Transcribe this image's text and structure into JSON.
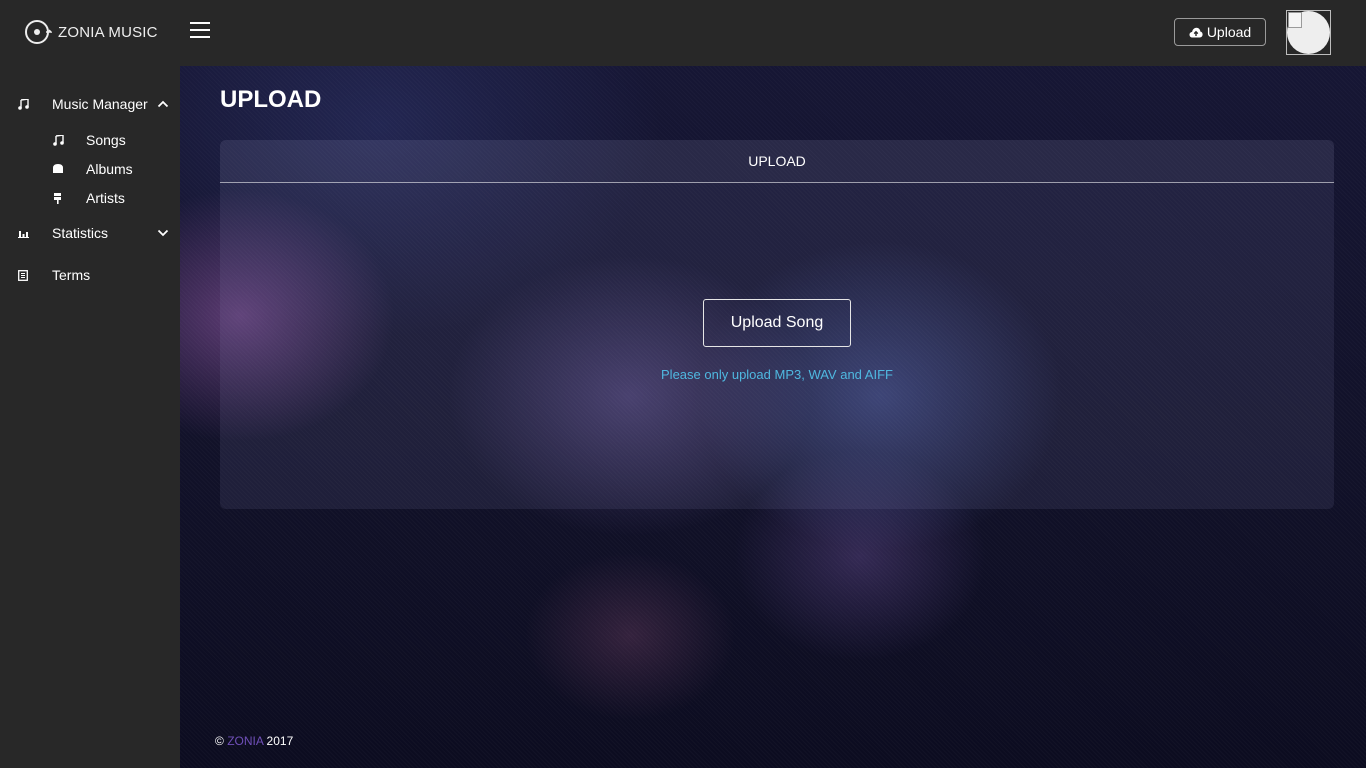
{
  "header": {
    "logo_text": "ZONIA MUSIC",
    "upload_button_label": "Upload"
  },
  "sidebar": {
    "items": [
      {
        "label": "Music Manager",
        "icon": "music-note-icon",
        "expanded": true
      },
      {
        "label": "Songs",
        "icon": "music-note-icon"
      },
      {
        "label": "Albums",
        "icon": "album-icon"
      },
      {
        "label": "Artists",
        "icon": "artist-icon"
      },
      {
        "label": "Statistics",
        "icon": "bar-chart-icon",
        "expanded": false
      },
      {
        "label": "Terms",
        "icon": "document-icon"
      }
    ]
  },
  "main": {
    "page_title": "UPLOAD",
    "card_title": "UPLOAD",
    "upload_song_label": "Upload Song",
    "hint": "Please only upload MP3, WAV and AIFF"
  },
  "footer": {
    "copyright": "©",
    "brand": "ZONIA",
    "year": "2017"
  },
  "colors": {
    "sidebar_bg": "#282828",
    "hint_text": "#4fb8e0",
    "footer_brand": "#6f4fb8"
  }
}
